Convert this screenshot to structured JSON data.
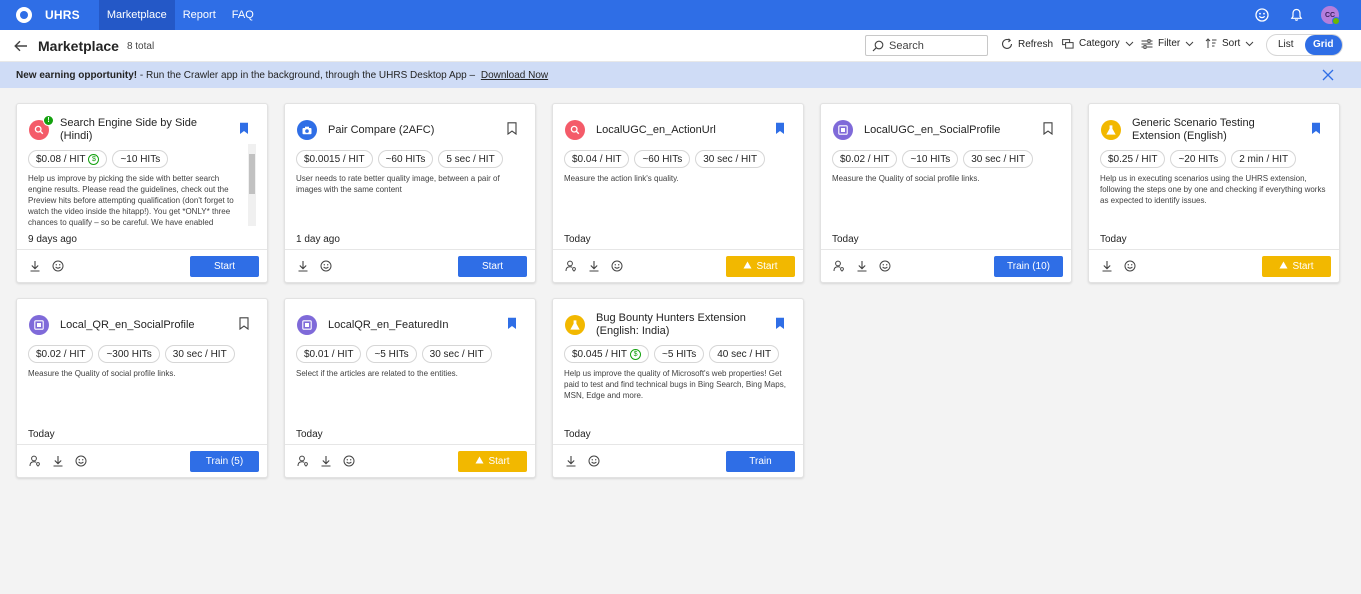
{
  "app": {
    "name": "UHRS",
    "nav": [
      "Marketplace",
      "Report",
      "FAQ"
    ],
    "user_initials": "CC"
  },
  "header": {
    "title": "Marketplace",
    "total": "8 total",
    "search_placeholder": "Search",
    "refresh": "Refresh",
    "category": "Category",
    "filter": "Filter",
    "sort": "Sort",
    "view_list": "List",
    "view_grid": "Grid"
  },
  "banner": {
    "lead": "New earning opportunity!",
    "text": " - Run the Crawler app in the background, through the UHRS Desktop App – ",
    "link": "Download Now"
  },
  "colors": {
    "accent": "#2f6ee6",
    "search_cat": "#f45b69",
    "image_cat": "#2f6ee6",
    "local_cat": "#7f6ad9",
    "extension_cat": "#f2b800"
  },
  "cards": [
    {
      "title": "Search Engine Side by Side (Hindi)",
      "icon": "search-icon",
      "bookmarked": true,
      "price": "$0.08 / HIT",
      "hits": "~10 HITs",
      "time": "",
      "desc": "Help us improve by picking the side with better search engine results. Please read the guidelines, check out the Preview hits before attempting qualification (don't forget to watch the video inside the hitapp!). You get *ONLY* three chances to qualify – so be careful. We have enabled",
      "date": "9 days ago",
      "button": "Start"
    },
    {
      "title": "Pair Compare (2AFC)",
      "icon": "camera-icon",
      "bookmarked": false,
      "price": "$0.0015 / HIT",
      "hits": "~60 HITs",
      "time": "5 sec / HIT",
      "desc": "User needs to rate better quality image, between a pair of images with the same content",
      "date": "1 day ago",
      "button": "Start"
    },
    {
      "title": "LocalUGC_en_ActionUrl",
      "icon": "search-icon",
      "bookmarked": true,
      "price": "$0.04 / HIT",
      "hits": "~60 HITs",
      "time": "30 sec / HIT",
      "desc": "Measure the action link's quality.",
      "date": "Today",
      "button": "Start"
    },
    {
      "title": "LocalUGC_en_SocialProfile",
      "icon": "local-icon",
      "bookmarked": false,
      "price": "$0.02 / HIT",
      "hits": "~10 HITs",
      "time": "30 sec / HIT",
      "desc": "Measure the Quality of social profile links.",
      "date": "Today",
      "button": "Train (10)"
    },
    {
      "title": "Generic Scenario Testing Extension (English)",
      "icon": "flask-icon",
      "bookmarked": true,
      "price": "$0.25 / HIT",
      "hits": "~20 HITs",
      "time": "2 min / HIT",
      "desc": "Help us in executing scenarios using the UHRS extension, following the steps one by one and checking if everything works as expected to identify issues.",
      "date": "Today",
      "button": "Start"
    },
    {
      "title": "Local_QR_en_SocialProfile",
      "icon": "local-icon",
      "bookmarked": false,
      "price": "$0.02 / HIT",
      "hits": "~300 HITs",
      "time": "30 sec / HIT",
      "desc": "Measure the Quality of social profile links.",
      "date": "Today",
      "button": "Train (5)"
    },
    {
      "title": "LocalQR_en_FeaturedIn",
      "icon": "local-icon",
      "bookmarked": true,
      "price": "$0.01 / HIT",
      "hits": "~5 HITs",
      "time": "30 sec / HIT",
      "desc": "Select if the articles are related to the entities.",
      "date": "Today",
      "button": "Start"
    },
    {
      "title": "Bug Bounty Hunters Extension (English: India)",
      "icon": "flask-icon",
      "bookmarked": true,
      "price": "$0.045 / HIT",
      "hits": "~5 HITs",
      "time": "40 sec / HIT",
      "desc": "Help us improve the quality of Microsoft's web properties! Get paid to test and find technical bugs in Bing Search, Bing Maps, MSN, Edge and more.",
      "date": "Today",
      "button": "Train"
    }
  ]
}
